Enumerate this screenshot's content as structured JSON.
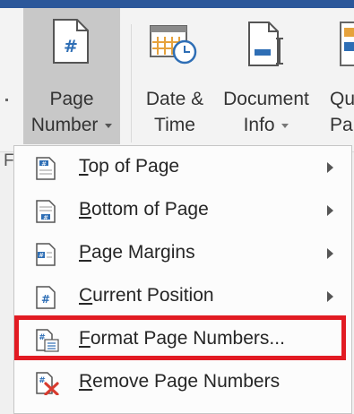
{
  "ribbon": {
    "buttons": [
      {
        "line1": "Page",
        "line2": "Number",
        "dropdown": true
      },
      {
        "line1": "Date &",
        "line2": "Time",
        "dropdown": false
      },
      {
        "line1": "Document",
        "line2": "Info",
        "dropdown": true
      },
      {
        "line1": "Qu",
        "line2": "Pa",
        "dropdown": false
      }
    ],
    "group_label_fragment": "F"
  },
  "menu": {
    "items": [
      {
        "accel": "T",
        "rest": "op of Page",
        "submenu": true,
        "icon": "header-page-number-icon"
      },
      {
        "accel": "B",
        "rest": "ottom of Page",
        "submenu": true,
        "icon": "footer-page-number-icon"
      },
      {
        "accel": "P",
        "rest": "age Margins",
        "submenu": true,
        "icon": "margin-page-number-icon"
      },
      {
        "accel": "C",
        "rest": "urrent Position",
        "submenu": true,
        "icon": "current-position-icon"
      },
      {
        "accel": "F",
        "rest": "ormat Page Numbers...",
        "submenu": false,
        "icon": "format-page-numbers-icon"
      },
      {
        "accel": "R",
        "rest": "emove Page Numbers",
        "submenu": false,
        "icon": "remove-page-numbers-icon"
      }
    ]
  },
  "colors": {
    "title_bar": "#2b579a",
    "highlight_box": "#e21b23",
    "selected_ribbon_button": "#c8c8c8",
    "icon_accent": "#2e6eb5",
    "remove_x": "#d83b2f"
  }
}
